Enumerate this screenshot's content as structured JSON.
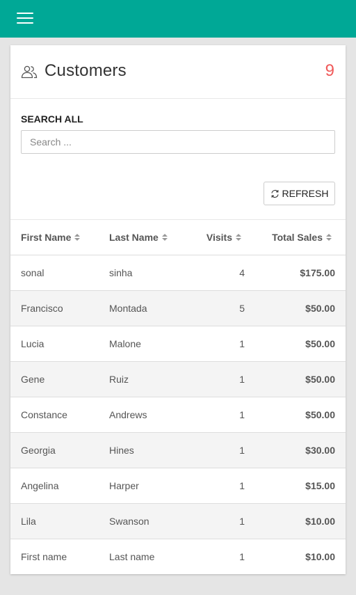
{
  "header": {
    "menu_icon": "hamburger-menu-icon",
    "brand_color": "#00a896"
  },
  "card": {
    "icon": "users-icon",
    "title": "Customers",
    "count": "9",
    "count_color": "#f05a5a"
  },
  "search": {
    "label": "SEARCH ALL",
    "placeholder": "Search ...",
    "value": ""
  },
  "refresh": {
    "label": "REFRESH",
    "icon": "refresh-icon"
  },
  "table": {
    "columns": [
      "First Name",
      "Last Name",
      "Visits",
      "Total Sales"
    ],
    "rows": [
      [
        "sonal",
        "sinha",
        "4",
        "$175.00"
      ],
      [
        "Francisco",
        "Montada",
        "5",
        "$50.00"
      ],
      [
        "Lucia",
        "Malone",
        "1",
        "$50.00"
      ],
      [
        "Gene",
        "Ruiz",
        "1",
        "$50.00"
      ],
      [
        "Constance",
        "Andrews",
        "1",
        "$50.00"
      ],
      [
        "Georgia",
        "Hines",
        "1",
        "$30.00"
      ],
      [
        "Angelina",
        "Harper",
        "1",
        "$15.00"
      ],
      [
        "Lila",
        "Swanson",
        "1",
        "$10.00"
      ],
      [
        "First name",
        "Last name",
        "1",
        "$10.00"
      ]
    ]
  }
}
